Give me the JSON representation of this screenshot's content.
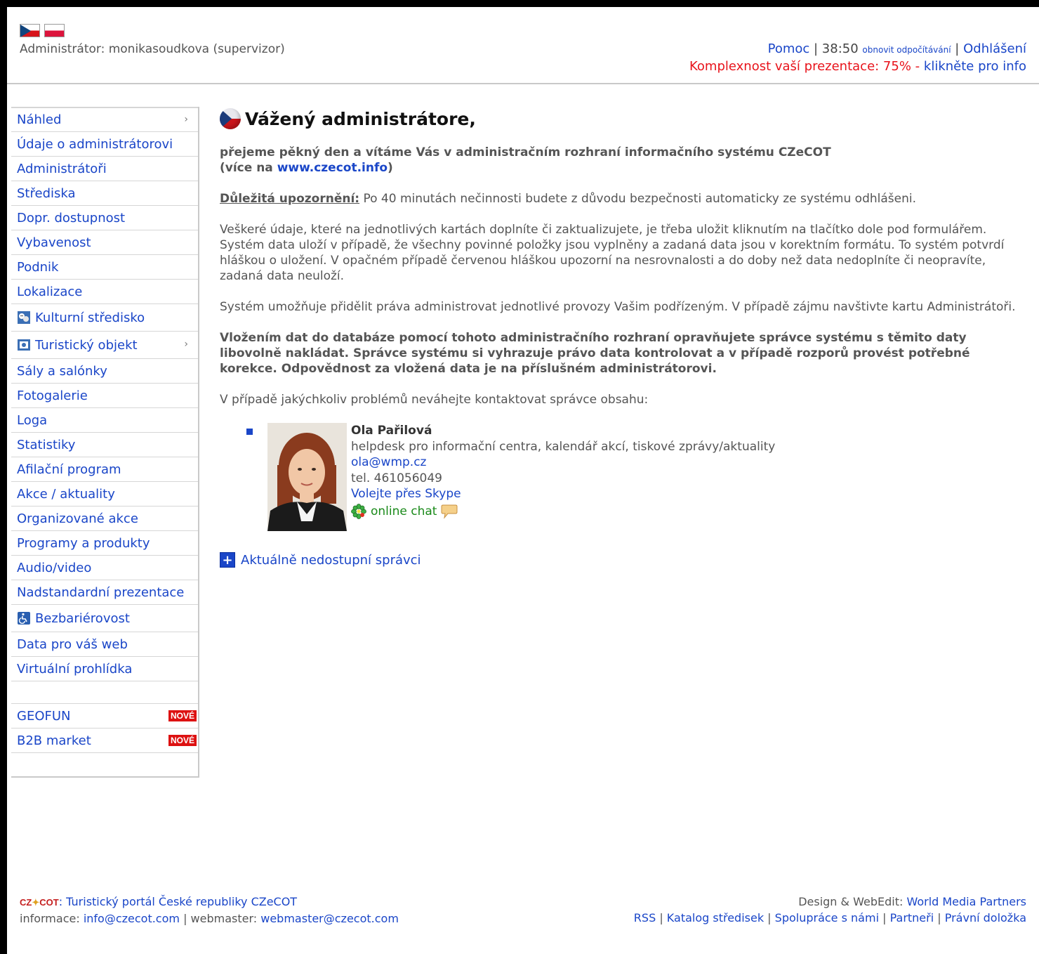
{
  "header": {
    "admin_label": "Administrátor: monikasoudkova (supervizor)",
    "help": "Pomoc",
    "sep": " | ",
    "timer": "38:50",
    "refresh": "obnovit odpočítávání",
    "logout": "Odhlášení",
    "complexity_text": "Komplexnost vaší prezentace: 75% - ",
    "complexity_link": "klikněte pro info"
  },
  "sidebar": {
    "items": [
      {
        "label": "Náhled"
      },
      {
        "label": "Údaje o administrátorovi"
      },
      {
        "label": "Administrátoři"
      },
      {
        "label": "Střediska"
      },
      {
        "label": "Dopr. dostupnost"
      },
      {
        "label": "Vybavenost"
      },
      {
        "label": "Podnik"
      },
      {
        "label": "Lokalizace"
      },
      {
        "label": "Kulturní středisko"
      },
      {
        "label": "Turistický objekt"
      },
      {
        "label": "Sály a salónky"
      },
      {
        "label": "Fotogalerie"
      },
      {
        "label": "Loga"
      },
      {
        "label": "Statistiky"
      },
      {
        "label": "Afilační program"
      },
      {
        "label": "Akce / aktuality"
      },
      {
        "label": "Organizované akce"
      },
      {
        "label": "Programy a produkty"
      },
      {
        "label": "Audio/video"
      },
      {
        "label": "Nadstandardní prezentace"
      },
      {
        "label": "Bezbariérovost"
      },
      {
        "label": "Data pro váš web"
      },
      {
        "label": "Virtuální prohlídka"
      }
    ],
    "extra": [
      {
        "label": "GEOFUN",
        "badge": "NOVÉ"
      },
      {
        "label": "B2B market",
        "badge": "NOVÉ"
      }
    ]
  },
  "main": {
    "title": "Vážený administrátore,",
    "intro_line1": "přejeme pěkný den a vítáme Vás v administračním rozhraní informačního systému CZeCOT",
    "intro_open": "(více na ",
    "intro_link": "www.czecot.info",
    "intro_close": ")",
    "warning_label": "Důležitá upozornění:",
    "warning_text": " Po 40 minutách nečinnosti budete z důvodu bezpečnosti automaticky ze systému odhlášeni.",
    "para_save": "Veškeré údaje, které na jednotlivých kartách doplníte či zaktualizujete, je třeba uložit kliknutím na tlačítko dole pod formulářem. Systém data uloží v případě, že všechny povinné položky jsou vyplněny a zadaná data jsou v korektním formátu. To systém potvrdí hláškou o uložení. V opačném případě červenou hláškou upozorní na nesrovnalosti a do doby než data nedoplníte či neopravíte, zadaná data neuloží.",
    "para_rights": "Systém umožňuje přidělit práva administrovat jednotlivé provozy Vašim podřízeným. V případě zájmu navštivte kartu Administrátoři.",
    "para_legal": "Vložením dat do databáze pomocí tohoto administračního rozhraní opravňujete správce systému s těmito daty libovolně nakládat. Správce systému si vyhrazuje právo data kontrolovat a v případě rozporů provést potřebné korekce. Odpovědnost za vložená data je na příslušném administrátorovi.",
    "para_contact": "V případě jakýchkoliv problémů neváhejte kontaktovat správce obsahu:",
    "contact": {
      "name": "Ola Pařilová",
      "role": "helpdesk pro informační centra, kalendář akcí, tiskové zprávy/aktuality",
      "email": "ola@wmp.cz",
      "phone": "tel. 461056049",
      "skype": "Volejte přes Skype",
      "chat": "online chat"
    },
    "unavailable": "Aktuálně nedostupní správci"
  },
  "footer": {
    "logo_text": "CZeCOT",
    "portal_label": ": Turistický portál České republiky CZeCOT",
    "info_label": "informace: ",
    "info_email": "info@czecot.com",
    "webmaster_label": " | webmaster: ",
    "webmaster_email": "webmaster@czecot.com",
    "design_label": "Design & WebEdit: ",
    "design_link": "World Media Partners",
    "links": [
      "RSS",
      "Katalog středisek",
      "Spolupráce s námi",
      "Partneři",
      "Právní doložka"
    ]
  },
  "colors": {
    "link": "#1a46c8",
    "warning_red": "#e8131b",
    "badge_red": "#dd1111",
    "chat_green": "#1a8a1a"
  }
}
